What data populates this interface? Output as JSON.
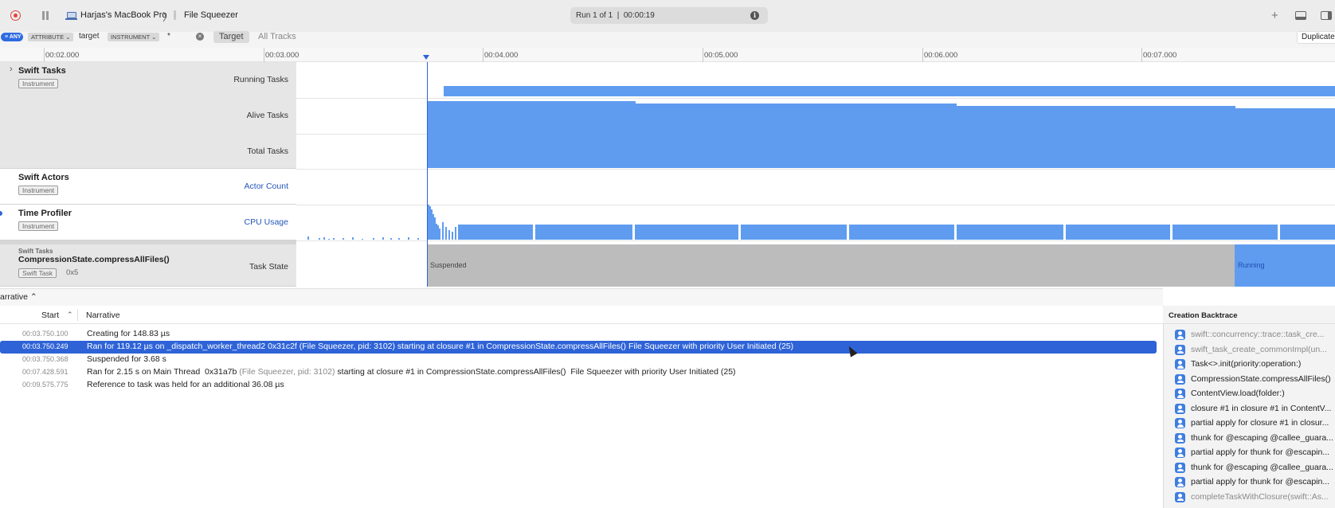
{
  "toolbar": {
    "device": "Harjas's MacBook Pro",
    "separator": "〉",
    "app": "File Squeezer",
    "run_status": "Run 1 of 1  |  00:00:19",
    "info_glyph": "i",
    "add_glyph": "+",
    "icons": [
      "record-icon",
      "pause-icon",
      "laptop-icon",
      "info-icon",
      "plus-icon",
      "bottom-panel-icon",
      "side-panel-icon"
    ]
  },
  "filter": {
    "any_label": "≡ ANY",
    "attribute_label": "ATTRIBUTE ⌄",
    "attribute_value": "target",
    "instrument_label": "INSTRUMENT ⌄",
    "instrument_value": "*",
    "clear_glyph": "×",
    "target_button": "Target",
    "all_tracks_button": "All Tracks",
    "duplicate_button": "Duplicate"
  },
  "ruler": {
    "ticks": [
      "00:02.000",
      "00:03.000",
      "00:04.000",
      "00:05.000",
      "00:06.000",
      "00:07.000"
    ]
  },
  "tracks": [
    {
      "name": "Swift Tasks",
      "badge": "Instrument",
      "disclosure": "›",
      "rows": [
        "Running Tasks",
        "Alive Tasks",
        "Total Tasks"
      ]
    },
    {
      "name": "Swift Actors",
      "badge": "Instrument",
      "rows": [
        "Actor Count"
      ]
    },
    {
      "name": "Time Profiler",
      "badge": "Instrument",
      "rows": [
        "CPU Usage"
      ]
    }
  ],
  "task_lane": {
    "category": "Swift Tasks",
    "name": "CompressionState.compressAllFiles()",
    "badge": "Swift Task",
    "id": "0x5",
    "row_label": "Task State",
    "states": [
      {
        "label": "Suspended",
        "from": "00:03.750",
        "to": "00:07.428",
        "color": "#bcbcbc"
      },
      {
        "label": "Running",
        "from": "00:07.428",
        "to": "00:07.850",
        "color": "#5f9cf0"
      }
    ]
  },
  "detail": {
    "picker_label": "arrative ⌃",
    "columns": {
      "start": "Start",
      "sort_arrow": "⌃",
      "narrative": "Narrative"
    },
    "rows": [
      {
        "start": "00:03.750.100",
        "text": "Creating for 148.83 µs",
        "dim": "",
        "rest": ""
      },
      {
        "start": "00:03.750.249",
        "text": "Ran for 119.12 µs on _dispatch_worker_thread2  0x31c2f (File Squeezer, pid: 3102) starting at closure #1 in CompressionState.compressAllFiles()  File Squeezer with priority User Initiated (25)",
        "dim": "",
        "rest": ""
      },
      {
        "start": "00:03.750.368",
        "text": "Suspended for 3.68 s",
        "dim": "",
        "rest": ""
      },
      {
        "start": "00:07.428.591",
        "text": "Ran for 2.15 s on Main Thread  0x31a7b ",
        "dim": "(File Squeezer, pid: 3102)",
        "rest": " starting at closure #1 in CompressionState.compressAllFiles()  File Squeezer with priority User Initiated (25)"
      },
      {
        "start": "00:09.575.775",
        "text": "Reference to task was held for an additional 36.08 µs",
        "dim": "",
        "rest": ""
      }
    ]
  },
  "backtrace": {
    "title": "Creation Backtrace",
    "frames": [
      {
        "label": "swift::concurrency::trace::task_cre...",
        "dim": true
      },
      {
        "label": "swift_task_create_commonImpl(un...",
        "dim": true
      },
      {
        "label": "Task<>.init(priority:operation:)",
        "dim": false
      },
      {
        "label": "CompressionState.compressAllFiles()",
        "dim": false
      },
      {
        "label": "ContentView.load(folder:)",
        "dim": false
      },
      {
        "label": "closure #1 in closure #1 in ContentV...",
        "dim": false
      },
      {
        "label": "partial apply for closure #1 in closur...",
        "dim": false
      },
      {
        "label": "thunk for @escaping @callee_guara...",
        "dim": false
      },
      {
        "label": "partial apply for thunk for @escapin...",
        "dim": false
      },
      {
        "label": "thunk for @escaping @callee_guara...",
        "dim": false
      },
      {
        "label": "partial apply for thunk for @escapin...",
        "dim": false
      },
      {
        "label": "completeTaskWithClosure(swift::As...",
        "dim": true
      }
    ]
  },
  "colors": {
    "graph_blue": "#5f9cf0",
    "selection_blue": "#2e63d8",
    "suspended_gray": "#bcbcbc",
    "record_red": "#e0443e"
  }
}
